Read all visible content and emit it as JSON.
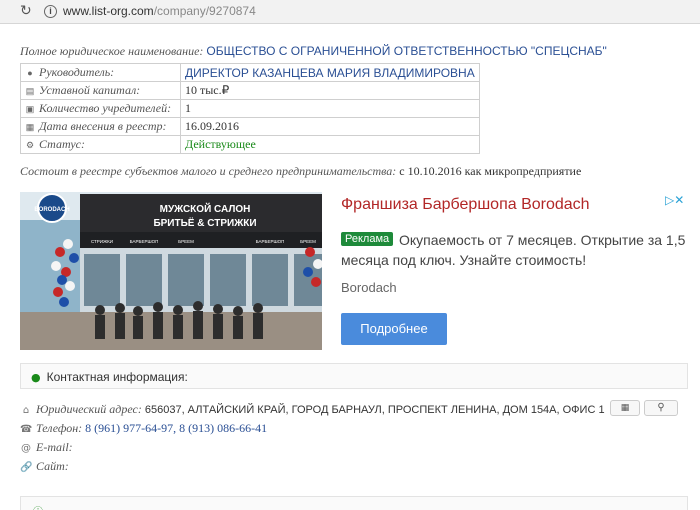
{
  "browser": {
    "url_domain": "www.list-org.com",
    "url_path": "/company/9270874"
  },
  "company": {
    "fullname_label": "Полное юридическое наименование:",
    "fullname_value": "ОБЩЕСТВО С ОГРАНИЧЕННОЙ ОТВЕТСТВЕННОСТЬЮ \"СПЕЦСНАБ\"",
    "rows": [
      {
        "label": "Руководитель:",
        "value": "ДИРЕКТОР КАЗАНЦЕВА МАРИЯ ВЛАДИМИРОВНА"
      },
      {
        "label": "Уставной капитал:",
        "value": "10 тыс.₽"
      },
      {
        "label": "Количество учредителей:",
        "value": "1"
      },
      {
        "label": "Дата внесения в реестр:",
        "value": "16.09.2016"
      },
      {
        "label": "Статус:",
        "value": "Действующее"
      }
    ],
    "sme_label": "Состоит в реестре субъектов малого и среднего предпринимательства:",
    "sme_value": "с 10.10.2016 как микропредприятие"
  },
  "ad": {
    "image_sign_brand": "BORODACH",
    "image_sign_title": "МУЖСКОЙ САЛОН",
    "image_sign_subtitle": "БРИТЬЁ & СТРИЖКИ",
    "image_window_labels": [
      "СТРИЖКИ",
      "БАРБЕРШОП",
      "БРЕЕМ",
      "",
      "БАРБЕРШОП",
      "БРЕЕМ"
    ],
    "title": "Франшиза Барбершопа Borodach",
    "badge": "Реклама",
    "description": "Окупаемость от 7 месяцев. Открытие за 1,5 месяца под ключ. Узнайте стоимость!",
    "advertiser": "Borodach",
    "button": "Подробнее"
  },
  "contacts": {
    "header": "Контактная информация:",
    "address_label": "Юридический адрес:",
    "address_value": "656037, АЛТАЙСКИЙ КРАЙ, ГОРОД БАРНАУЛ, ПРОСПЕКТ ЛЕНИНА, ДОМ 154А, ОФИС 1",
    "phone_label": "Телефон:",
    "phone_value": "8 (961) 977-64-97, 8 (913) 086-66-41",
    "email_label": "E-mail:",
    "site_label": "Сайт:"
  },
  "colors": {
    "link_blue": "#2a4f94",
    "status_green": "#1a8a1a",
    "ad_title_red": "#b22727",
    "ad_button_blue": "#4a8bdc"
  }
}
